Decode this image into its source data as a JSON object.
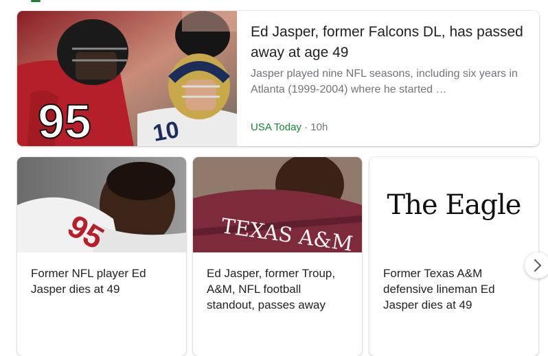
{
  "top_story": {
    "title": "Ed Jasper, former Falcons DL, has passed away at age 49",
    "snippet": "Jasper played nine NFL seasons, including six years in Atlanta (1999-2004) where he started …",
    "source": "USA Today",
    "separator": " · ",
    "age": "10h",
    "image_jersey_numbers": [
      "95",
      "10"
    ]
  },
  "cards": [
    {
      "title": "Former NFL player Ed Jasper dies at 49",
      "image_jersey_text": "95"
    },
    {
      "title": "Ed Jasper, former Troup, A&M, NFL football standout, passes away",
      "image_jersey_text": "TEXAS A&M"
    },
    {
      "title": "Former Texas A&M defensive lineman Ed Jasper dies at 49",
      "logo_text": "The Eagle"
    }
  ],
  "icons": {
    "next": "chevron-right-icon"
  },
  "colors": {
    "source": "#188038",
    "falcons_red": "#b51f2a",
    "aggie_maroon": "#7d2b3a"
  }
}
